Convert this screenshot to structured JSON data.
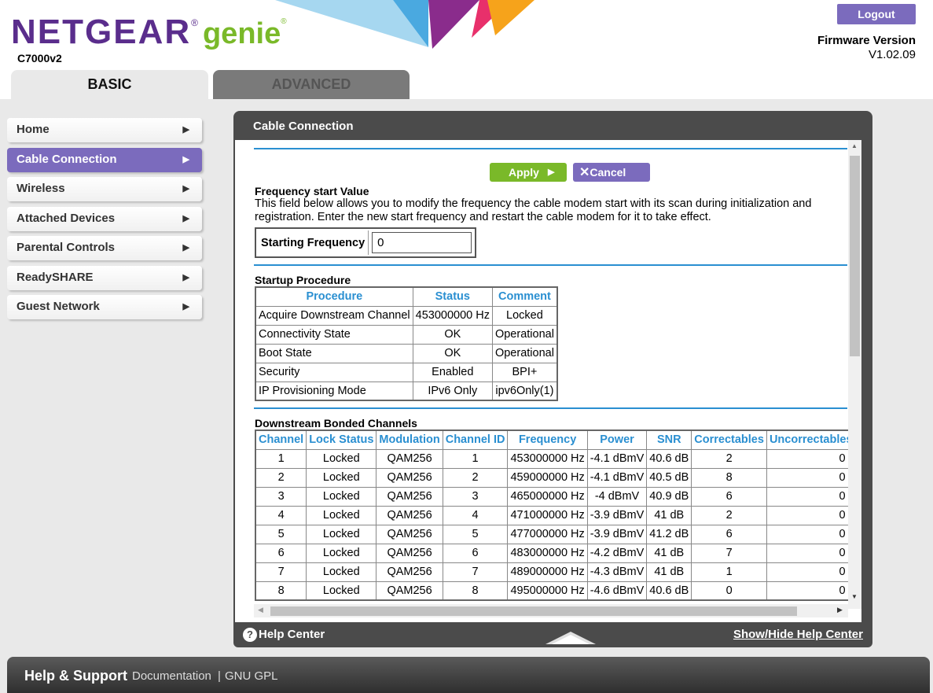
{
  "header": {
    "brand": "NETGEAR",
    "product": "genie",
    "model": "C7000v2",
    "logout_label": "Logout",
    "firmware_label": "Firmware Version",
    "firmware_version": "V1.02.09",
    "tabs": [
      "BASIC",
      "ADVANCED"
    ]
  },
  "colors": {
    "purple": "#7b6bbd",
    "green": "#7ab929",
    "blue": "#2a8fd1",
    "dark": "#4b4b4b"
  },
  "sidebar": {
    "items": [
      {
        "label": "Home"
      },
      {
        "label": "Cable Connection",
        "active": true
      },
      {
        "label": "Wireless"
      },
      {
        "label": "Attached Devices"
      },
      {
        "label": "Parental Controls"
      },
      {
        "label": "ReadySHARE"
      },
      {
        "label": "Guest Network"
      }
    ]
  },
  "panel": {
    "title": "Cable Connection",
    "apply_label": "Apply",
    "cancel_label": "Cancel",
    "frequency": {
      "title": "Frequency start Value",
      "description": "This field below allows you to modify the frequency the cable modem start with its scan during initialization and registration. Enter the new start frequency and restart the cable modem for it to take effect.",
      "label": "Starting Frequency",
      "value": "0"
    },
    "startup": {
      "title": "Startup Procedure",
      "headers": [
        "Procedure",
        "Status",
        "Comment"
      ],
      "rows": [
        [
          "Acquire Downstream Channel",
          "453000000 Hz",
          "Locked"
        ],
        [
          "Connectivity State",
          "OK",
          "Operational"
        ],
        [
          "Boot State",
          "OK",
          "Operational"
        ],
        [
          "Security",
          "Enabled",
          "BPI+"
        ],
        [
          "IP Provisioning Mode",
          "IPv6 Only",
          "ipv6Only(1)"
        ]
      ]
    },
    "downstream": {
      "title": "Downstream Bonded Channels",
      "headers": [
        "Channel",
        "Lock Status",
        "Modulation",
        "Channel ID",
        "Frequency",
        "Power",
        "SNR",
        "Correctables",
        "Uncorrectables"
      ],
      "rows": [
        [
          "1",
          "Locked",
          "QAM256",
          "1",
          "453000000 Hz",
          "-4.1 dBmV",
          "40.6 dB",
          "2",
          "0"
        ],
        [
          "2",
          "Locked",
          "QAM256",
          "2",
          "459000000 Hz",
          "-4.1 dBmV",
          "40.5 dB",
          "8",
          "0"
        ],
        [
          "3",
          "Locked",
          "QAM256",
          "3",
          "465000000 Hz",
          "-4 dBmV",
          "40.9 dB",
          "6",
          "0"
        ],
        [
          "4",
          "Locked",
          "QAM256",
          "4",
          "471000000 Hz",
          "-3.9 dBmV",
          "41 dB",
          "2",
          "0"
        ],
        [
          "5",
          "Locked",
          "QAM256",
          "5",
          "477000000 Hz",
          "-3.9 dBmV",
          "41.2 dB",
          "6",
          "0"
        ],
        [
          "6",
          "Locked",
          "QAM256",
          "6",
          "483000000 Hz",
          "-4.2 dBmV",
          "41 dB",
          "7",
          "0"
        ],
        [
          "7",
          "Locked",
          "QAM256",
          "7",
          "489000000 Hz",
          "-4.3 dBmV",
          "41 dB",
          "1",
          "0"
        ],
        [
          "8",
          "Locked",
          "QAM256",
          "8",
          "495000000 Hz",
          "-4.6 dBmV",
          "40.6 dB",
          "0",
          "0"
        ]
      ]
    },
    "help_label": "Help Center",
    "showhide_label": "Show/Hide Help Center"
  },
  "footer": {
    "title": "Help & Support",
    "documentation": "Documentation",
    "separator": "|",
    "gpl": "GNU GPL"
  }
}
